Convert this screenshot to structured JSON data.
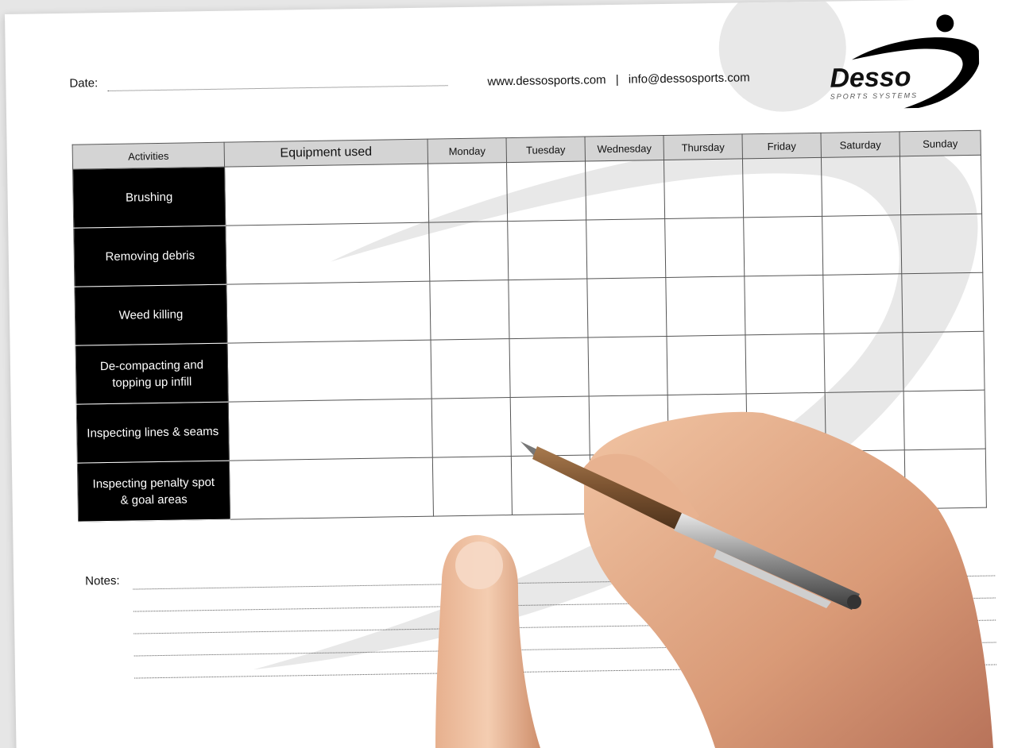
{
  "header": {
    "date_label": "Date:",
    "website": "www.dessosports.com",
    "separator": "|",
    "email": "info@dessosports.com"
  },
  "logo": {
    "icon": "desso-swoosh-logo",
    "brand": "Desso",
    "tagline": "SPORTS SYSTEMS"
  },
  "table": {
    "headers": [
      "Activities",
      "Equipment used",
      "Monday",
      "Tuesday",
      "Wednesday",
      "Thursday",
      "Friday",
      "Saturday",
      "Sunday"
    ],
    "activities": [
      "Brushing",
      "Removing debris",
      "Weed killing",
      "De-compacting and\ntopping up infill",
      "Inspecting lines & seams",
      "Inspecting penalty spot\n& goal areas"
    ]
  },
  "notes": {
    "label": "Notes:"
  },
  "colors": {
    "header_fill": "#d4d4d4",
    "activity_fill": "#000000",
    "watermark": "#e8e8e8"
  }
}
